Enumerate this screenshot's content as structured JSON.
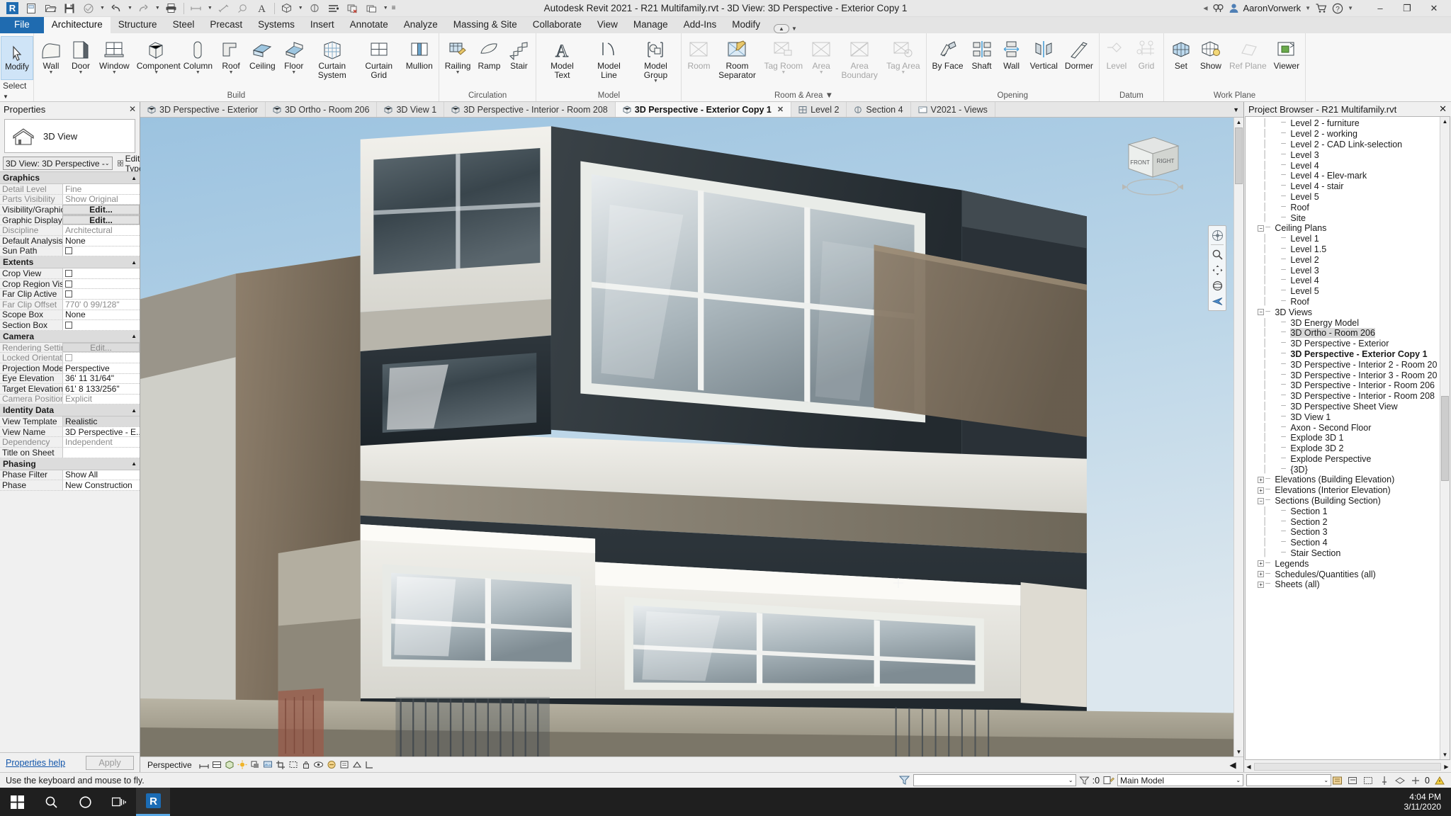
{
  "window": {
    "title": "Autodesk Revit 2021 - R21 Multifamily.rvt - 3D View: 3D Perspective - Exterior Copy 1",
    "user": "AaronVorwerk",
    "minimize": "–",
    "restore": "❐",
    "close": "✕"
  },
  "quick_access": [
    {
      "name": "revit-logo-icon",
      "label": "R"
    },
    {
      "name": "new-file-icon",
      "label": "New"
    },
    {
      "name": "open-file-icon",
      "label": "Open"
    },
    {
      "name": "save-icon",
      "label": "Save"
    },
    {
      "name": "save-as-icon",
      "label": "Save As"
    },
    {
      "name": "undo-icon",
      "label": "Undo"
    },
    {
      "name": "redo-icon",
      "label": "Redo"
    },
    {
      "name": "print-icon",
      "label": "Print"
    },
    {
      "name": "measure-icon",
      "label": "Measure"
    },
    {
      "name": "aligned-dimension-icon",
      "label": "Aligned Dimension"
    },
    {
      "name": "tag-icon",
      "label": "Tag"
    },
    {
      "name": "text-icon",
      "label": "Text"
    },
    {
      "name": "default-3d-view-icon",
      "label": "Default 3D View"
    },
    {
      "name": "section-icon",
      "label": "Section"
    },
    {
      "name": "thin-lines-icon",
      "label": "Thin Lines"
    },
    {
      "name": "close-hidden-windows-icon",
      "label": "Close Hidden Windows"
    },
    {
      "name": "switch-windows-icon",
      "label": "Switch Windows"
    },
    {
      "name": "customize-qat-icon",
      "label": "Customize Quick Access Toolbar"
    }
  ],
  "ribbon": {
    "tabs": [
      {
        "label": "File",
        "state": "file"
      },
      {
        "label": "Architecture",
        "state": "active"
      },
      {
        "label": "Structure",
        "state": "normal"
      },
      {
        "label": "Steel",
        "state": "normal"
      },
      {
        "label": "Precast",
        "state": "normal"
      },
      {
        "label": "Systems",
        "state": "normal"
      },
      {
        "label": "Insert",
        "state": "normal"
      },
      {
        "label": "Annotate",
        "state": "normal"
      },
      {
        "label": "Analyze",
        "state": "normal"
      },
      {
        "label": "Massing & Site",
        "state": "normal"
      },
      {
        "label": "Collaborate",
        "state": "normal"
      },
      {
        "label": "View",
        "state": "normal"
      },
      {
        "label": "Manage",
        "state": "normal"
      },
      {
        "label": "Add-Ins",
        "state": "normal"
      },
      {
        "label": "Modify",
        "state": "normal"
      }
    ],
    "select_label": "Select",
    "modify_label": "Modify",
    "panels": [
      {
        "label": "Build",
        "buttons": [
          {
            "label": "Wall",
            "icon": "wall-icon",
            "caret": true,
            "disabled": false
          },
          {
            "label": "Door",
            "icon": "door-icon",
            "caret": true,
            "disabled": false
          },
          {
            "label": "Window",
            "icon": "window-icon",
            "caret": true,
            "disabled": false
          },
          {
            "label": "Component",
            "icon": "component-icon",
            "caret": true,
            "disabled": false
          },
          {
            "label": "Column",
            "icon": "column-icon",
            "caret": true,
            "disabled": false
          },
          {
            "label": "Roof",
            "icon": "roof-icon",
            "caret": true,
            "disabled": false
          },
          {
            "label": "Ceiling",
            "icon": "ceiling-icon",
            "caret": false,
            "disabled": false
          },
          {
            "label": "Floor",
            "icon": "floor-icon",
            "caret": true,
            "disabled": false
          },
          {
            "label": "Curtain System",
            "icon": "curtain-system-icon",
            "caret": false,
            "disabled": false
          },
          {
            "label": "Curtain Grid",
            "icon": "curtain-grid-icon",
            "caret": false,
            "disabled": false
          },
          {
            "label": "Mullion",
            "icon": "mullion-icon",
            "caret": false,
            "disabled": false
          }
        ]
      },
      {
        "label": "Circulation",
        "buttons": [
          {
            "label": "Railing",
            "icon": "railing-icon",
            "caret": true,
            "disabled": false
          },
          {
            "label": "Ramp",
            "icon": "ramp-icon",
            "caret": false,
            "disabled": false
          },
          {
            "label": "Stair",
            "icon": "stair-icon",
            "caret": false,
            "disabled": false
          }
        ]
      },
      {
        "label": "Model",
        "buttons": [
          {
            "label": "Model Text",
            "icon": "model-text-icon",
            "caret": false,
            "disabled": false
          },
          {
            "label": "Model Line",
            "icon": "model-line-icon",
            "caret": false,
            "disabled": false
          },
          {
            "label": "Model Group",
            "icon": "model-group-icon",
            "caret": true,
            "disabled": false
          }
        ]
      },
      {
        "label": "Room & Area",
        "caret": true,
        "buttons": [
          {
            "label": "Room",
            "icon": "room-icon",
            "caret": false,
            "disabled": true
          },
          {
            "label": "Room Separator",
            "icon": "room-separator-icon",
            "caret": false,
            "disabled": false
          },
          {
            "label": "Tag Room",
            "icon": "tag-room-icon",
            "caret": true,
            "disabled": true
          },
          {
            "label": "Area",
            "icon": "area-icon",
            "caret": true,
            "disabled": true
          },
          {
            "label": "Area Boundary",
            "icon": "area-boundary-icon",
            "caret": false,
            "disabled": true
          },
          {
            "label": "Tag Area",
            "icon": "tag-area-icon",
            "caret": true,
            "disabled": true
          }
        ]
      },
      {
        "label": "Opening",
        "buttons": [
          {
            "label": "By Face",
            "icon": "opening-by-face-icon",
            "caret": false,
            "disabled": false
          },
          {
            "label": "Shaft",
            "icon": "shaft-opening-icon",
            "caret": false,
            "disabled": false
          },
          {
            "label": "Wall",
            "icon": "wall-opening-icon",
            "caret": false,
            "disabled": false
          },
          {
            "label": "Vertical",
            "icon": "vertical-opening-icon",
            "caret": false,
            "disabled": false
          },
          {
            "label": "Dormer",
            "icon": "dormer-opening-icon",
            "caret": false,
            "disabled": false
          }
        ]
      },
      {
        "label": "Datum",
        "buttons": [
          {
            "label": "Level",
            "icon": "level-icon",
            "caret": false,
            "disabled": true
          },
          {
            "label": "Grid",
            "icon": "grid-icon",
            "caret": false,
            "disabled": true
          }
        ]
      },
      {
        "label": "Work Plane",
        "buttons": [
          {
            "label": "Set",
            "icon": "set-workplane-icon",
            "caret": false,
            "disabled": false
          },
          {
            "label": "Show",
            "icon": "show-workplane-icon",
            "caret": false,
            "disabled": false
          },
          {
            "label": "Ref Plane",
            "icon": "ref-plane-icon",
            "caret": false,
            "disabled": true
          },
          {
            "label": "Viewer",
            "icon": "workplane-viewer-icon",
            "caret": false,
            "disabled": false
          }
        ]
      }
    ]
  },
  "properties": {
    "title": "Properties",
    "type_name": "3D View",
    "selector_value": "3D View: 3D Perspective -",
    "edit_type_label": "Edit Type",
    "help_link": "Properties help",
    "apply_label": "Apply",
    "groups": [
      {
        "name": "Graphics",
        "rows": [
          {
            "key": "Detail Level",
            "value": "Fine",
            "kind": "text",
            "dim": true
          },
          {
            "key": "Parts Visibility",
            "value": "Show Original",
            "kind": "text",
            "dim": true
          },
          {
            "key": "Visibility/Graphics...",
            "value": "Edit...",
            "kind": "button",
            "dim": false
          },
          {
            "key": "Graphic Display O...",
            "value": "Edit...",
            "kind": "button",
            "dim": false
          },
          {
            "key": "Discipline",
            "value": "Architectural",
            "kind": "text",
            "dim": true
          },
          {
            "key": "Default Analysis D...",
            "value": "None",
            "kind": "text",
            "dim": false
          },
          {
            "key": "Sun Path",
            "value": "",
            "kind": "checkbox",
            "dim": false
          }
        ]
      },
      {
        "name": "Extents",
        "rows": [
          {
            "key": "Crop View",
            "value": "",
            "kind": "checkbox",
            "dim": false
          },
          {
            "key": "Crop Region Visible",
            "value": "",
            "kind": "checkbox",
            "dim": false
          },
          {
            "key": "Far Clip Active",
            "value": "",
            "kind": "checkbox",
            "dim": false
          },
          {
            "key": "Far Clip Offset",
            "value": "770'  0 99/128\"",
            "kind": "text",
            "dim": true
          },
          {
            "key": "Scope Box",
            "value": "None",
            "kind": "text",
            "dim": false
          },
          {
            "key": "Section Box",
            "value": "",
            "kind": "checkbox",
            "dim": false
          }
        ]
      },
      {
        "name": "Camera",
        "rows": [
          {
            "key": "Rendering Settings",
            "value": "Edit...",
            "kind": "greybutton",
            "dim": true
          },
          {
            "key": "Locked Orientation",
            "value": "",
            "kind": "checkbox-dim",
            "dim": true
          },
          {
            "key": "Projection Mode",
            "value": "Perspective",
            "kind": "text",
            "dim": false
          },
          {
            "key": "Eye Elevation",
            "value": "36'  11 31/64\"",
            "kind": "text",
            "dim": false
          },
          {
            "key": "Target Elevation",
            "value": "61'  8 133/256\"",
            "kind": "text",
            "dim": false
          },
          {
            "key": "Camera Position",
            "value": "Explicit",
            "kind": "text",
            "dim": true
          }
        ]
      },
      {
        "name": "Identity Data",
        "rows": [
          {
            "key": "View Template",
            "value": "Realistic",
            "kind": "selected",
            "dim": false
          },
          {
            "key": "View Name",
            "value": "3D Perspective - E...",
            "kind": "text",
            "dim": false
          },
          {
            "key": "Dependency",
            "value": "Independent",
            "kind": "text",
            "dim": true
          },
          {
            "key": "Title on Sheet",
            "value": "",
            "kind": "text",
            "dim": false
          }
        ]
      },
      {
        "name": "Phasing",
        "rows": [
          {
            "key": "Phase Filter",
            "value": "Show All",
            "kind": "text",
            "dim": false
          },
          {
            "key": "Phase",
            "value": "New Construction",
            "kind": "text",
            "dim": false
          }
        ]
      }
    ]
  },
  "view_tabs": [
    {
      "label": "3D Perspective - Exterior",
      "icon": "view-3d-icon",
      "active": false,
      "closable": false
    },
    {
      "label": "3D Ortho - Room 206",
      "icon": "view-3d-icon",
      "active": false,
      "closable": false
    },
    {
      "label": "3D View 1",
      "icon": "view-3d-icon",
      "active": false,
      "closable": false
    },
    {
      "label": "3D Perspective - Interior - Room 208",
      "icon": "view-3d-icon",
      "active": false,
      "closable": false
    },
    {
      "label": "3D Perspective - Exterior Copy 1",
      "icon": "view-3d-icon",
      "active": true,
      "closable": true
    },
    {
      "label": "Level 2",
      "icon": "floor-plan-icon",
      "active": false,
      "closable": false
    },
    {
      "label": "Section 4",
      "icon": "section-view-icon",
      "active": false,
      "closable": false
    },
    {
      "label": "V2021 - Views",
      "icon": "sheet-icon",
      "active": false,
      "closable": false
    }
  ],
  "view_control_bar": {
    "projection_label": "Perspective",
    "icons": [
      "scale-icon",
      "detail-level-icon",
      "visual-style-icon",
      "sun-path-icon",
      "shadows-icon",
      "render-icon",
      "crop-view-icon",
      "show-crop-icon",
      "lock-3d-view-icon",
      "temporary-hide-isolate-icon",
      "reveal-hidden-icon",
      "temporary-view-properties-icon",
      "analytical-model-icon",
      "constraints-icon"
    ]
  },
  "view_cube": {
    "front": "FRONT",
    "right": "RIGHT"
  },
  "nav_bar": {
    "icons": [
      "steering-wheel-icon",
      "zoom-region-icon",
      "pan-icon",
      "orbit-icon",
      "look-icon"
    ]
  },
  "project_browser": {
    "title": "Project Browser - R21 Multifamily.rvt",
    "close_label": "✕",
    "nodes": [
      {
        "label": "Level 2 - furniture",
        "depth": 2,
        "type": "leaf"
      },
      {
        "label": "Level 2 - working",
        "depth": 2,
        "type": "leaf"
      },
      {
        "label": "Level 2 - CAD Link-selection",
        "depth": 2,
        "type": "leaf"
      },
      {
        "label": "Level 3",
        "depth": 2,
        "type": "leaf"
      },
      {
        "label": "Level 4",
        "depth": 2,
        "type": "leaf"
      },
      {
        "label": "Level 4 - Elev-mark",
        "depth": 2,
        "type": "leaf"
      },
      {
        "label": "Level 4 - stair",
        "depth": 2,
        "type": "leaf"
      },
      {
        "label": "Level 5",
        "depth": 2,
        "type": "leaf"
      },
      {
        "label": "Roof",
        "depth": 2,
        "type": "leaf"
      },
      {
        "label": "Site",
        "depth": 2,
        "type": "last"
      },
      {
        "label": "Ceiling Plans",
        "depth": 1,
        "type": "expanded"
      },
      {
        "label": "Level 1",
        "depth": 2,
        "type": "leaf"
      },
      {
        "label": "Level 1.5",
        "depth": 2,
        "type": "leaf"
      },
      {
        "label": "Level 2",
        "depth": 2,
        "type": "leaf"
      },
      {
        "label": "Level 3",
        "depth": 2,
        "type": "leaf"
      },
      {
        "label": "Level 4",
        "depth": 2,
        "type": "leaf"
      },
      {
        "label": "Level 5",
        "depth": 2,
        "type": "leaf"
      },
      {
        "label": "Roof",
        "depth": 2,
        "type": "last"
      },
      {
        "label": "3D Views",
        "depth": 1,
        "type": "expanded"
      },
      {
        "label": "3D Energy Model",
        "depth": 2,
        "type": "leaf"
      },
      {
        "label": "3D Ortho - Room 206",
        "depth": 2,
        "type": "leaf",
        "selected": true
      },
      {
        "label": "3D Perspective - Exterior",
        "depth": 2,
        "type": "leaf"
      },
      {
        "label": "3D Perspective - Exterior Copy 1",
        "depth": 2,
        "type": "leaf",
        "bold": true
      },
      {
        "label": "3D Perspective - Interior 2 - Room 20",
        "depth": 2,
        "type": "leaf"
      },
      {
        "label": "3D Perspective - Interior 3 - Room 20",
        "depth": 2,
        "type": "leaf"
      },
      {
        "label": "3D Perspective - Interior - Room 206",
        "depth": 2,
        "type": "leaf"
      },
      {
        "label": "3D Perspective - Interior - Room 208",
        "depth": 2,
        "type": "leaf"
      },
      {
        "label": "3D Perspective Sheet View",
        "depth": 2,
        "type": "leaf"
      },
      {
        "label": "3D View 1",
        "depth": 2,
        "type": "leaf"
      },
      {
        "label": "Axon - Second Floor",
        "depth": 2,
        "type": "leaf"
      },
      {
        "label": "Explode 3D 1",
        "depth": 2,
        "type": "leaf"
      },
      {
        "label": "Explode 3D 2",
        "depth": 2,
        "type": "leaf"
      },
      {
        "label": "Explode Perspective",
        "depth": 2,
        "type": "leaf"
      },
      {
        "label": "{3D}",
        "depth": 2,
        "type": "last"
      },
      {
        "label": "Elevations (Building Elevation)",
        "depth": 1,
        "type": "collapsed"
      },
      {
        "label": "Elevations (Interior Elevation)",
        "depth": 1,
        "type": "collapsed"
      },
      {
        "label": "Sections (Building Section)",
        "depth": 1,
        "type": "expanded"
      },
      {
        "label": "Section 1",
        "depth": 2,
        "type": "leaf"
      },
      {
        "label": "Section 2",
        "depth": 2,
        "type": "leaf"
      },
      {
        "label": "Section 3",
        "depth": 2,
        "type": "leaf"
      },
      {
        "label": "Section 4",
        "depth": 2,
        "type": "leaf"
      },
      {
        "label": "Stair Section",
        "depth": 2,
        "type": "last"
      },
      {
        "label": "Legends",
        "depth": 1,
        "type": "collapsed"
      },
      {
        "label": "Schedules/Quantities (all)",
        "depth": 1,
        "type": "collapsed"
      },
      {
        "label": "Sheets (all)",
        "depth": 1,
        "type": "collapsed"
      }
    ]
  },
  "status_bar": {
    "message": "Use the keyboard and mouse to fly.",
    "filter_value": "",
    "count": ":0",
    "worksets": "Main Model",
    "design_option": "",
    "exclude_count": "0"
  },
  "taskbar": {
    "items": [
      {
        "name": "start-button",
        "icon": "windows-logo-icon"
      },
      {
        "name": "search-button",
        "icon": "search-icon"
      },
      {
        "name": "cortana-button",
        "icon": "circle-icon"
      },
      {
        "name": "task-view-button",
        "icon": "task-view-icon"
      },
      {
        "name": "revit-taskbar-button",
        "icon": "revit-logo-icon"
      }
    ],
    "time": "4:04 PM",
    "date": "3/11/2020"
  },
  "colors": {
    "accent": "#1f6bb0",
    "ribbon_bg": "#f7f7f7",
    "sky_top": "#a9cbe4",
    "sky_bottom": "#cfe0ec",
    "dark_facade": "#2c3338",
    "light_facade": "#e9e9e4"
  }
}
